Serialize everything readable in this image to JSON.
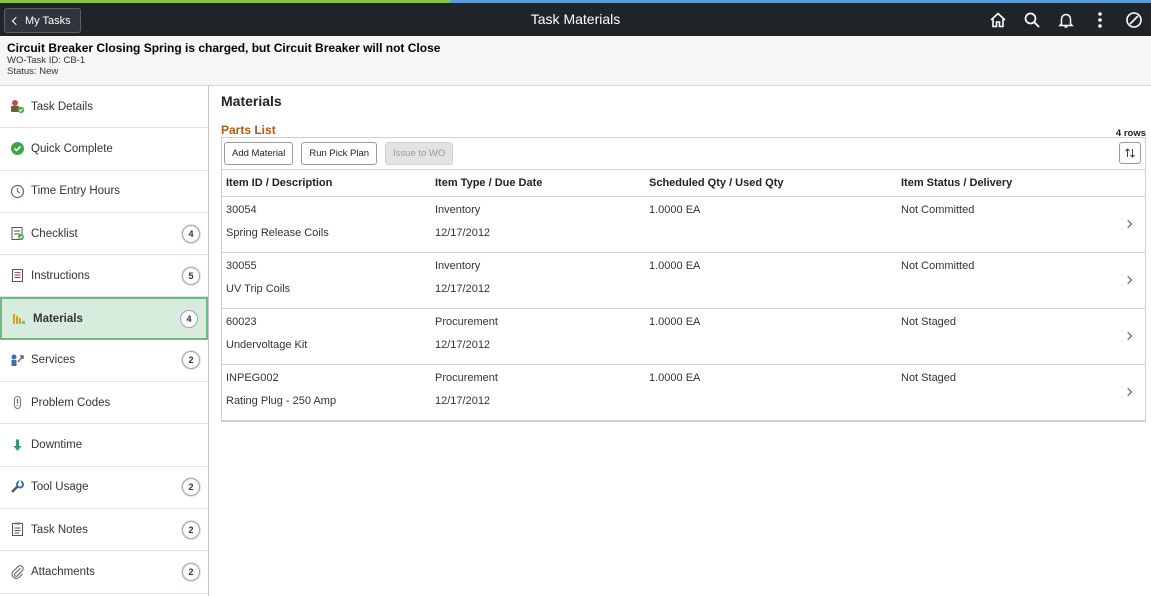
{
  "topbar": {
    "back_label": "My Tasks",
    "title": "Task Materials",
    "icons": [
      "home-icon",
      "search-icon",
      "bell-icon",
      "more-options-icon",
      "navbar-icon"
    ]
  },
  "header": {
    "title": "Circuit Breaker Closing Spring is charged, but Circuit Breaker will not Close",
    "task_id_label": "WO-Task ID:",
    "task_id": "CB-1",
    "status_label": "Status:",
    "status": "New"
  },
  "sidebar": {
    "items": [
      {
        "label": "Task Details",
        "icon": "task-details-icon",
        "badge": ""
      },
      {
        "label": "Quick Complete",
        "icon": "check-circle-icon",
        "badge": ""
      },
      {
        "label": "Time Entry Hours",
        "icon": "clock-icon",
        "badge": ""
      },
      {
        "label": "Checklist",
        "icon": "checklist-icon",
        "badge": "4"
      },
      {
        "label": "Instructions",
        "icon": "document-icon",
        "badge": "5"
      },
      {
        "label": "Materials",
        "icon": "materials-icon",
        "badge": "4"
      },
      {
        "label": "Services",
        "icon": "services-icon",
        "badge": "2"
      },
      {
        "label": "Problem Codes",
        "icon": "problem-codes-icon",
        "badge": ""
      },
      {
        "label": "Downtime",
        "icon": "down-arrow-icon",
        "badge": ""
      },
      {
        "label": "Tool Usage",
        "icon": "tool-icon",
        "badge": "2"
      },
      {
        "label": "Task Notes",
        "icon": "notes-icon",
        "badge": "2"
      },
      {
        "label": "Attachments",
        "icon": "paperclip-icon",
        "badge": "2"
      }
    ]
  },
  "main": {
    "title": "Materials",
    "parts_list_title": "Parts List",
    "rows_count": "4 rows",
    "buttons": {
      "add_material": "Add Material",
      "run_pick_plan": "Run Pick Plan",
      "issue_to_wo": "Issue to WO"
    },
    "columns": [
      "Item ID / Description",
      "Item Type / Due Date",
      "Scheduled Qty / Used Qty",
      "Item Status / Delivery"
    ],
    "rows": [
      {
        "item_id": "30054",
        "description": "Spring Release Coils",
        "item_type": "Inventory",
        "due_date": "12/17/2012",
        "qty": "1.0000  EA",
        "status": "Not Committed"
      },
      {
        "item_id": "30055",
        "description": "UV Trip Coils",
        "item_type": "Inventory",
        "due_date": "12/17/2012",
        "qty": "1.0000  EA",
        "status": "Not Committed"
      },
      {
        "item_id": "60023",
        "description": "Undervoltage Kit",
        "item_type": "Procurement",
        "due_date": "12/17/2012",
        "qty": "1.0000  EA",
        "status": "Not Staged"
      },
      {
        "item_id": "INPEG002",
        "description": "Rating Plug - 250 Amp",
        "item_type": "Procurement",
        "due_date": "12/17/2012",
        "qty": "1.0000  EA",
        "status": "Not Staged"
      }
    ]
  },
  "colors": {
    "topbar_bg": "#1f2429",
    "accent_green": "#8cc63f",
    "accent_blue": "#5b9bd5",
    "active_nav_bg": "#d7ecdc",
    "active_nav_border": "#6dba80",
    "section_title": "#b05a12"
  }
}
